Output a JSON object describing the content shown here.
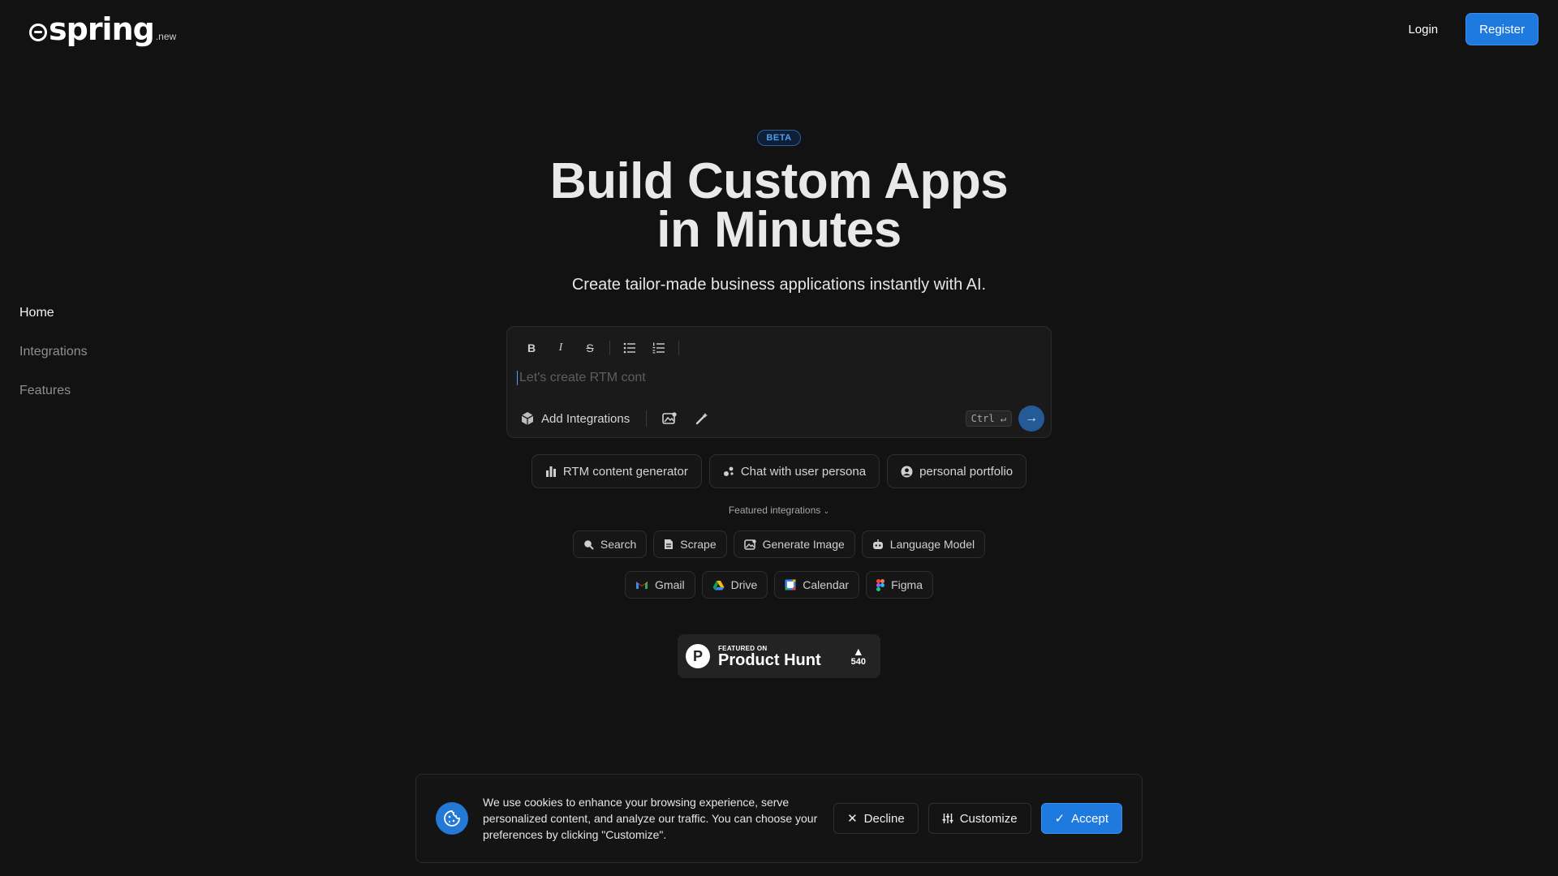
{
  "header": {
    "logo_word": "spring",
    "logo_suffix": ".new",
    "login_label": "Login",
    "register_label": "Register"
  },
  "sidebar": {
    "items": [
      {
        "label": "Home",
        "active": true
      },
      {
        "label": "Integrations",
        "active": false
      },
      {
        "label": "Features",
        "active": false
      }
    ]
  },
  "hero": {
    "badge": "BETA",
    "title_line1": "Build Custom Apps",
    "title_line2": "in Minutes",
    "subtitle": "Create tailor-made business applications instantly with AI."
  },
  "editor": {
    "toolbar": {
      "bold": "B",
      "italic": "I",
      "strikethrough": "S"
    },
    "placeholder": "Let's create RTM cont",
    "value": "",
    "add_integrations_label": "Add Integrations",
    "shortcut": "Ctrl ↵"
  },
  "suggestions": [
    {
      "label": "RTM content generator",
      "icon": "bar-chart-icon"
    },
    {
      "label": "Chat with user persona",
      "icon": "chat-persona-icon"
    },
    {
      "label": "personal portfolio",
      "icon": "user-circle-icon"
    }
  ],
  "featured_label": "Featured integrations",
  "integrations": {
    "row1": [
      {
        "label": "Search",
        "icon": "search-icon"
      },
      {
        "label": "Scrape",
        "icon": "document-icon"
      },
      {
        "label": "Generate Image",
        "icon": "image-icon"
      },
      {
        "label": "Language Model",
        "icon": "robot-icon"
      }
    ],
    "row2": [
      {
        "label": "Gmail",
        "icon": "gmail-icon"
      },
      {
        "label": "Drive",
        "icon": "drive-icon"
      },
      {
        "label": "Calendar",
        "icon": "calendar-icon"
      },
      {
        "label": "Figma",
        "icon": "figma-icon"
      }
    ]
  },
  "product_hunt": {
    "small": "FEATURED ON",
    "big": "Product Hunt",
    "votes": "540"
  },
  "cookie": {
    "text": "We use cookies to enhance your browsing experience, serve personalized content, and analyze our traffic. You can choose your preferences by clicking \"Customize\".",
    "decline_label": "Decline",
    "customize_label": "Customize",
    "accept_label": "Accept"
  },
  "colors": {
    "background": "#121212",
    "accent": "#1f7ae0",
    "beta": "#4d9ef6"
  }
}
